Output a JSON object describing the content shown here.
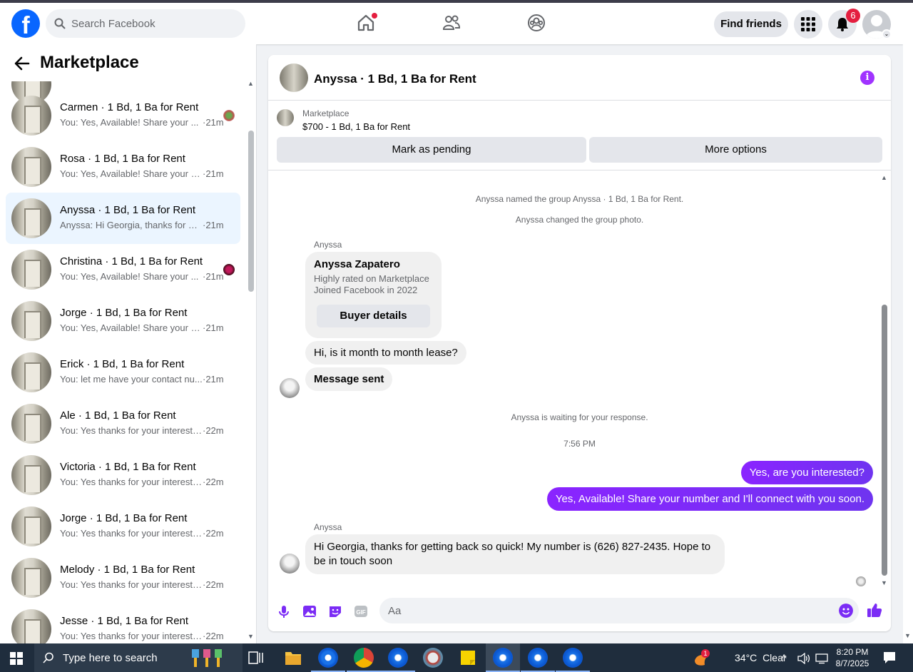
{
  "header": {
    "search_placeholder": "Search Facebook",
    "find_friends": "Find friends",
    "notification_count": "6"
  },
  "sidebar": {
    "title": "Marketplace",
    "conversations": [
      {
        "name": "Carmen · 1 Bd, 1 Ba for Rent",
        "snippet": "You: Yes, Available! Share your ...",
        "time": "·21m"
      },
      {
        "name": "Rosa · 1 Bd, 1 Ba for Rent",
        "snippet": "You: Yes, Available! Share your nu...",
        "time": "·21m"
      },
      {
        "name": "Anyssa · 1 Bd, 1 Ba for Rent",
        "snippet": "Anyssa: Hi Georgia, thanks for ge...",
        "time": "·21m"
      },
      {
        "name": "Christina · 1 Bd, 1 Ba for Rent",
        "snippet": "You: Yes, Available! Share your ...",
        "time": "·21m"
      },
      {
        "name": "Jorge · 1 Bd, 1 Ba for Rent",
        "snippet": "You: Yes, Available! Share your nu...",
        "time": "·21m"
      },
      {
        "name": "Erick · 1 Bd, 1 Ba for Rent",
        "snippet": "You: let me have your contact nu...",
        "time": "·21m"
      },
      {
        "name": "Ale · 1 Bd, 1 Ba for Rent",
        "snippet": "You: Yes thanks for your interest f...",
        "time": "·22m"
      },
      {
        "name": "Victoria · 1 Bd, 1 Ba for Rent",
        "snippet": "You: Yes thanks for your interest f...",
        "time": "·22m"
      },
      {
        "name": "Jorge · 1 Bd, 1 Ba for Rent",
        "snippet": "You: Yes thanks for your interest f...",
        "time": "·22m"
      },
      {
        "name": "Melody · 1 Bd, 1 Ba for Rent",
        "snippet": "You: Yes thanks for your interest f...",
        "time": "·22m"
      },
      {
        "name": "Jesse · 1 Bd, 1 Ba for Rent",
        "snippet": "You: Yes thanks for your interest f...",
        "time": "·22m"
      }
    ]
  },
  "chat": {
    "title": "Anyssa · 1 Bd, 1 Ba for Rent",
    "listing_source": "Marketplace",
    "listing_price": "$700 - 1 Bd, 1 Ba for Rent",
    "mark_pending": "Mark as pending",
    "more_options": "More options",
    "sys_named": "Anyssa named the group Anyssa · 1 Bd, 1 Ba for Rent.",
    "sys_photo": "Anyssa changed the group photo.",
    "sender_1": "Anyssa",
    "card_name": "Anyssa Zapatero",
    "card_line1": "Highly rated on Marketplace",
    "card_line2": "Joined Facebook in 2022",
    "card_button": "Buyer details",
    "msg_in_1": "Hi, is it month to month lease?",
    "msg_in_2": "Message sent",
    "sys_waiting": "Anyssa is waiting for your response.",
    "timestamp": "7:56 PM",
    "msg_out_1": "Yes, are you interested?",
    "msg_out_2": "Yes, Available! Share your number and I'll connect with you soon.",
    "sender_2": "Anyssa",
    "msg_in_3": "Hi Georgia, thanks for getting back so quick! My number is (626) 827-2435. Hope to be in touch soon",
    "composer_placeholder": "Aa"
  },
  "taskbar": {
    "search_text": "Type here to search",
    "temperature": "34°C",
    "weather": "Clear",
    "time": "8:20 PM",
    "date": "8/7/2025",
    "weather_badge": "1"
  },
  "colors": {
    "brand": "#0866ff",
    "outgoing_bubble": "#7b2cf5",
    "active_conversation": "#ebf5ff"
  }
}
